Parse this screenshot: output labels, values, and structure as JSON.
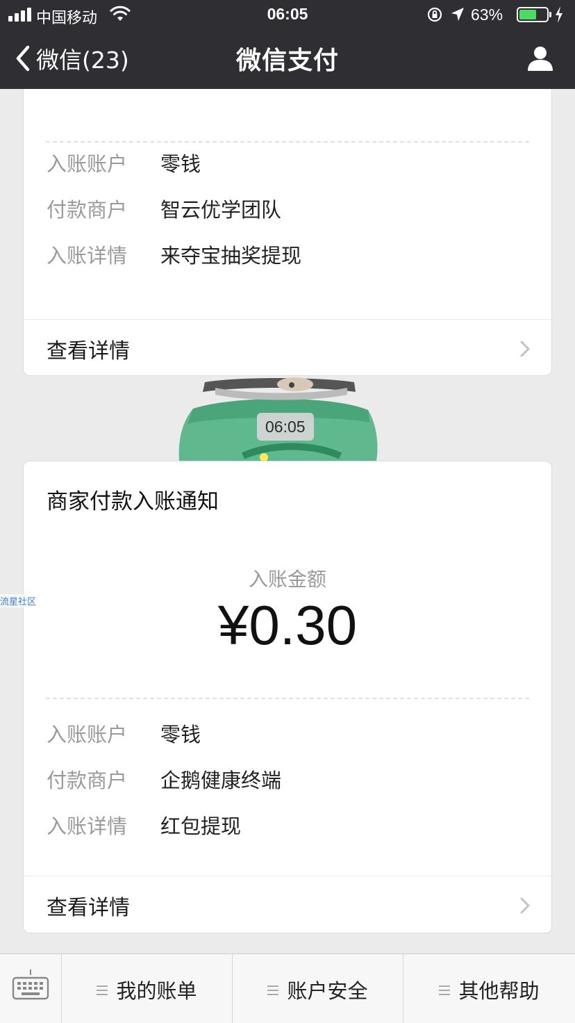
{
  "status_bar": {
    "carrier": "中国移动",
    "time": "06:05",
    "battery_percent_label": "63%",
    "battery_level": 0.63,
    "battery_color": "#4cd964"
  },
  "nav": {
    "back_label": "微信(23)",
    "title": "微信支付",
    "right_icon": "profile-icon"
  },
  "cards": [
    {
      "fields": [
        {
          "label": "入账账户",
          "value": "零钱"
        },
        {
          "label": "付款商户",
          "value": "智云优学团队"
        },
        {
          "label": "入账详情",
          "value": "来夺宝抽奖提现"
        }
      ],
      "detail_link": "查看详情"
    },
    {
      "title": "商家付款入账通知",
      "amount_label": "入账金额",
      "amount": "¥0.30",
      "fields": [
        {
          "label": "入账账户",
          "value": "零钱"
        },
        {
          "label": "付款商户",
          "value": "企鹅健康终端"
        },
        {
          "label": "入账详情",
          "value": "红包提现"
        }
      ],
      "detail_link": "查看详情"
    }
  ],
  "timestamp_pill": "06:05",
  "watermark": "流星社区",
  "bottom_menu": {
    "keyboard_icon": "keyboard-icon",
    "items": [
      {
        "label": "我的账单"
      },
      {
        "label": "账户安全"
      },
      {
        "label": "其他帮助"
      }
    ]
  },
  "colors": {
    "nav_bg": "#2e2e33",
    "page_bg": "#ebebeb",
    "muted_text": "#9a9a9a"
  }
}
